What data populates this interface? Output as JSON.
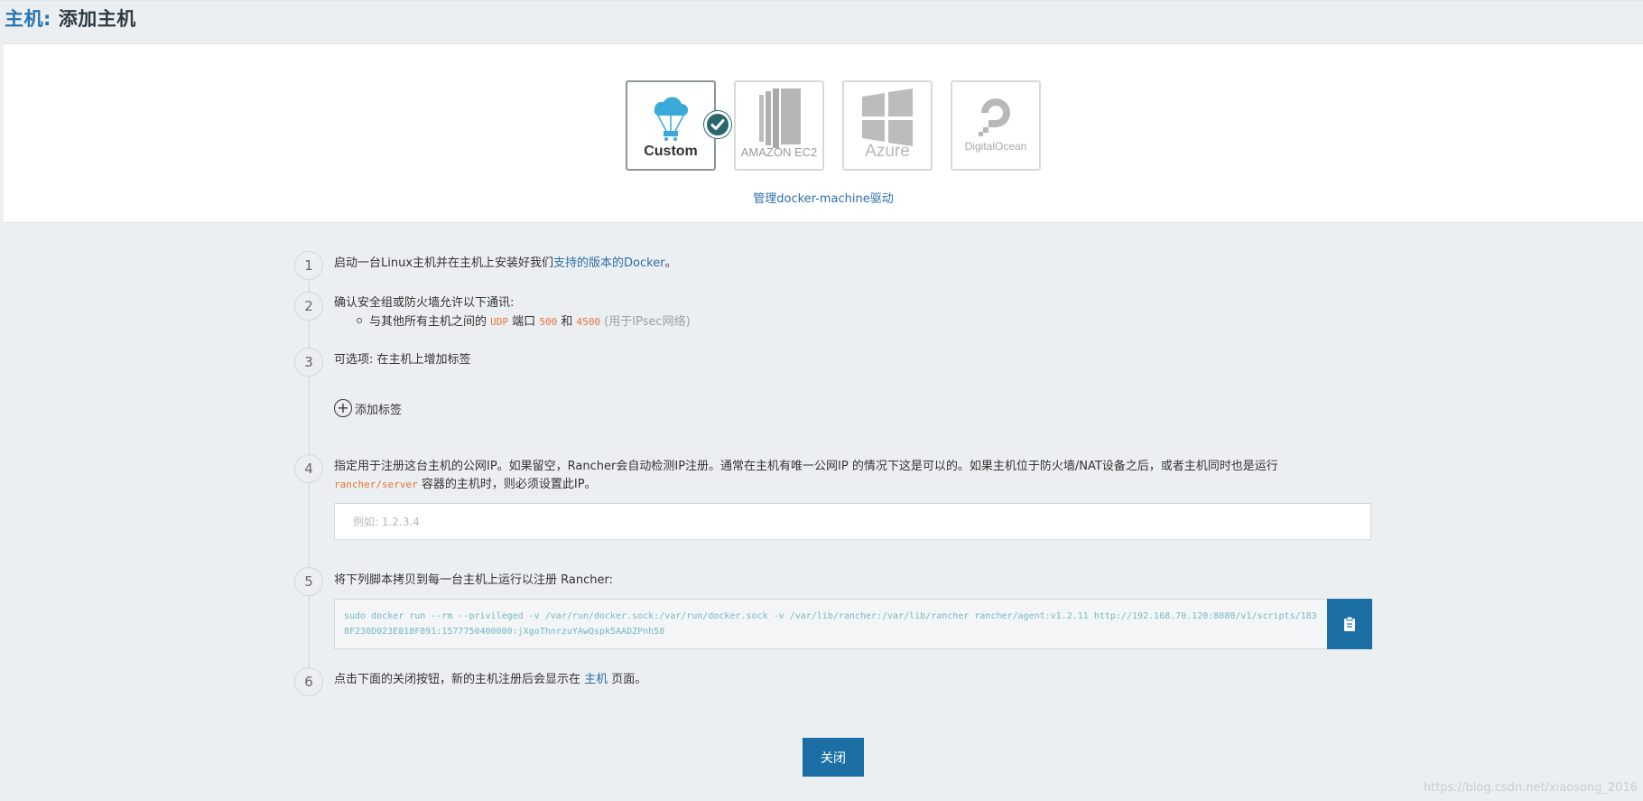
{
  "header": {
    "crumb": "主机:",
    "title": "添加主机"
  },
  "drivers": {
    "items": [
      {
        "label": "Custom",
        "selected": true,
        "icon": "parachute-cloud-icon"
      },
      {
        "label": "AMAZON EC2",
        "selected": false,
        "icon": "amazon-ec2-logo"
      },
      {
        "label": "Azure",
        "selected": false,
        "icon": "azure-windows-logo"
      },
      {
        "label": "DigitalOcean",
        "selected": false,
        "icon": "digitalocean-logo"
      }
    ],
    "manage_link": "管理docker-machine驱动"
  },
  "steps": {
    "s1": {
      "num": "1",
      "pre": "启动一台Linux主机并在主机上安装好我们",
      "link1": "支持的版本的",
      "link2": "Docker",
      "post": "。"
    },
    "s2": {
      "num": "2",
      "text": "确认安全组或防火墙允许以下通讯:",
      "bullet_pre": "与其他所有主机之间的",
      "protocol": "UDP",
      "port_word": "端口",
      "port1": "500",
      "and": "和",
      "port2": "4500",
      "note": "(用于IPsec网络)"
    },
    "s3": {
      "num": "3",
      "text": "可选项: 在主机上增加标签",
      "add_label": "添加标签"
    },
    "s4": {
      "num": "4",
      "text_line1": "指定用于注册这台主机的公网IP。如果留空，Rancher会自动检测IP注册。通常在主机有唯一公网IP 的情况下这是可以的。如果主机位于防火墙/NAT设备之后，或者主机同时也是运行",
      "code": "rancher/server",
      "text_line2": "容器的主机时，则必须设置此IP。",
      "placeholder": "例如: 1.2.3.4"
    },
    "s5": {
      "num": "5",
      "text": "将下列脚本拷贝到每一台主机上运行以注册 Rancher:",
      "script": "sudo docker run --rm --privileged -v /var/run/docker.sock:/var/run/docker.sock -v /var/lib/rancher:/var/lib/rancher rancher/agent:v1.2.11 http://192.168.70.120:8080/v1/scripts/1838F230D023E818F891:1577750400000:jXgoThnrzuYAwQspk5AADZPnh58"
    },
    "s6": {
      "num": "6",
      "pre": "点击下面的关闭按钮，新的主机注册后会显示在 ",
      "link": "主机",
      "post": " 页面。"
    }
  },
  "close_label": "关闭",
  "watermark": "https://blog.csdn.net/xiaosong_2016",
  "colors": {
    "accent": "#1c6fa5",
    "link": "#2b6ea8",
    "check": "#29676d",
    "code": "#e2743a"
  }
}
